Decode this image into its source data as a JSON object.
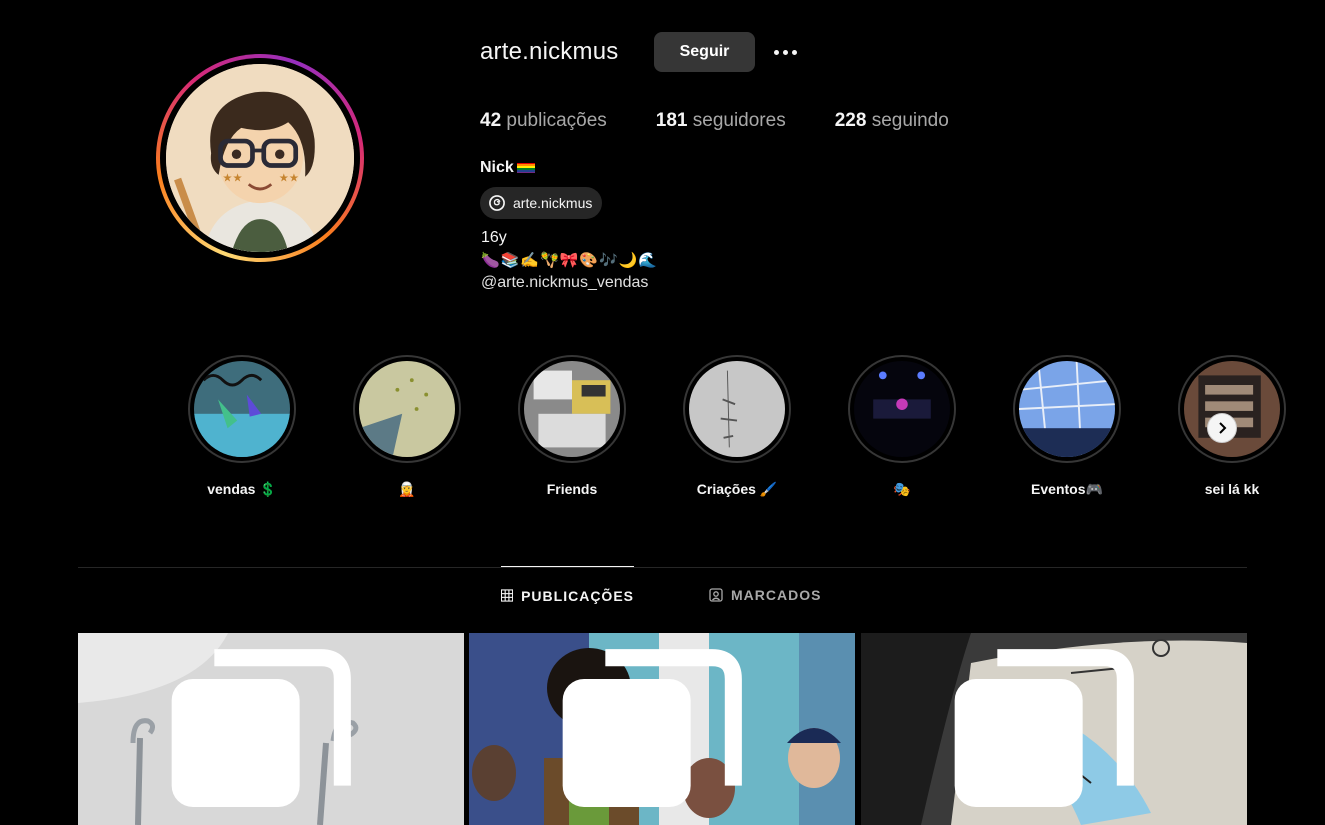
{
  "profile": {
    "username": "arte.nickmus",
    "follow_label": "Seguir",
    "stats": {
      "posts_count": "42",
      "posts_label": "publicações",
      "followers_count": "181",
      "followers_label": "seguidores",
      "following_count": "228",
      "following_label": "seguindo"
    },
    "display_name": "Nick",
    "threads_handle": "arte.nickmus",
    "bio_line1": "16y",
    "bio_emojis": "🍆📚✍️🪇🎀🎨🎶🌙🌊",
    "bio_link": "@arte.nickmus_vendas"
  },
  "highlights": [
    {
      "label": "vendas 💲"
    },
    {
      "label": "🧝"
    },
    {
      "label": "Friends"
    },
    {
      "label": "Criações 🖌️"
    },
    {
      "label": "🎭"
    },
    {
      "label": "Eventos🎮"
    },
    {
      "label": "sei lá kk"
    }
  ],
  "tabs": {
    "posts": "PUBLICAÇÕES",
    "tagged": "MARCADOS"
  },
  "colors": {
    "background": "#000000",
    "button": "#363636",
    "muted_text": "#a8a8a8"
  }
}
